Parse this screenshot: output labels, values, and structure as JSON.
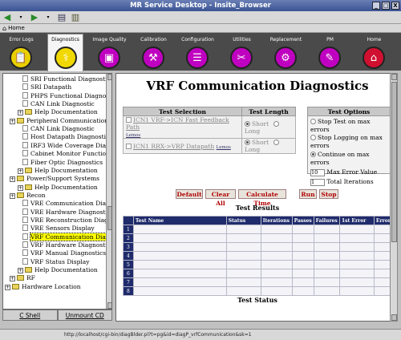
{
  "window": {
    "title": "MR Service Desktop - Insite_Browser",
    "controls": [
      "_",
      "□",
      "X"
    ]
  },
  "toolbar": {
    "home_label": "Home"
  },
  "nav": {
    "tabs": [
      {
        "label": "Error Logs",
        "icon": "📋",
        "color": "#e8d000"
      },
      {
        "label": "Diagnostics",
        "icon": "⚕",
        "color": "#f0d800"
      },
      {
        "label": "Image Quality",
        "icon": "▣",
        "color": "#c000c0"
      },
      {
        "label": "Calibration",
        "icon": "⚒",
        "color": "#c000c0"
      },
      {
        "label": "Configuration",
        "icon": "☰",
        "color": "#c000c0"
      },
      {
        "label": "Utilities",
        "icon": "✂",
        "color": "#c000c0"
      },
      {
        "label": "Replacement",
        "icon": "⚙",
        "color": "#c000c0"
      },
      {
        "label": "PM",
        "icon": "✎",
        "color": "#c000c0"
      },
      {
        "label": "Home",
        "icon": "⌂",
        "color": "#d01030"
      }
    ]
  },
  "tree": {
    "items": [
      {
        "label": "SRI Functional Diagnostics",
        "kind": "doc",
        "indent": 2
      },
      {
        "label": "SRI Datapath",
        "kind": "doc",
        "indent": 2
      },
      {
        "label": "PHPS Functional Diagnostics",
        "kind": "doc",
        "indent": 2
      },
      {
        "label": "CAN Link Diagnostic",
        "kind": "doc",
        "indent": 2
      },
      {
        "label": "Help Documentation",
        "kind": "folder",
        "indent": 1
      },
      {
        "label": "Peripheral Communications",
        "kind": "folder",
        "indent": 0
      },
      {
        "label": "CAN Link Diagnostic",
        "kind": "doc",
        "indent": 2
      },
      {
        "label": "Host Datapath Diagnostic",
        "kind": "doc",
        "indent": 2
      },
      {
        "label": "IRF3 Wide Coverage Diagnost",
        "kind": "doc",
        "indent": 2
      },
      {
        "label": "Cabinet Monitor Functional Di",
        "kind": "doc",
        "indent": 2
      },
      {
        "label": "Fiber Optic Diagnostics",
        "kind": "doc",
        "indent": 2
      },
      {
        "label": "Help Documentation",
        "kind": "folder",
        "indent": 1
      },
      {
        "label": "Power/Support Systems",
        "kind": "folder",
        "indent": 0
      },
      {
        "label": "Help Documentation",
        "kind": "folder",
        "indent": 1
      },
      {
        "label": "Recon",
        "kind": "folder",
        "indent": 0
      },
      {
        "label": "VRE Communication Diagnos",
        "kind": "doc",
        "indent": 2
      },
      {
        "label": "VRE Hardware Diagnostics",
        "kind": "doc",
        "indent": 2
      },
      {
        "label": "VRE Reconstruction Diagnost",
        "kind": "doc",
        "indent": 2
      },
      {
        "label": "VRE Sensors Display",
        "kind": "doc",
        "indent": 2
      },
      {
        "label": "VRF Communication Diagnos",
        "kind": "doc",
        "indent": 2,
        "selected": true
      },
      {
        "label": "VRF Hardware Diagnostics",
        "kind": "doc",
        "indent": 2
      },
      {
        "label": "VRF Manual Diagnostics",
        "kind": "doc",
        "indent": 2
      },
      {
        "label": "VRF Status Display",
        "kind": "doc",
        "indent": 2
      },
      {
        "label": "Help Documentation",
        "kind": "folder",
        "indent": 1
      },
      {
        "label": "RF",
        "kind": "folder",
        "indent": 0
      },
      {
        "label": "Hardware Location",
        "kind": "folder",
        "indent": -1
      }
    ]
  },
  "bottom_tabs": [
    "C Shell",
    "Unmount CD"
  ],
  "page": {
    "title": "VRF Communication Diagnostics",
    "test_selection": {
      "header": "Test Selection",
      "length_header": "Test Length",
      "rows": [
        {
          "name": "ICN1 VRF->ICN Fast Feedback Path",
          "link": "Lemos",
          "short": "Short",
          "long": "Long"
        },
        {
          "name": "ICN1 RRX->VRP Datapath",
          "link": "Lemos",
          "short": "Short",
          "long": "Long"
        }
      ]
    },
    "test_options": {
      "header": "Test Options",
      "radios": [
        "Stop Test on max errors",
        "Stop Logging on max errors",
        "Continue on max errors"
      ],
      "max_error_value": "10",
      "max_error_label": "Max Error Value",
      "total_iterations_value": "1",
      "total_iterations_label": "Total Iterations"
    },
    "buttons": [
      "Default",
      "Clear All",
      "Calculate Time",
      "Run",
      "Stop"
    ],
    "results": {
      "title": "Test Results",
      "columns": [
        "Test Name",
        "Status",
        "Iterations",
        "Passes",
        "Failures",
        "1st Error",
        "Errors"
      ],
      "rows": [
        "1",
        "2",
        "3",
        "4",
        "5",
        "6",
        "7",
        "8"
      ]
    },
    "status_title": "Test Status"
  },
  "statusbar": {
    "url": "http://localhost/cgi-bin/diagBlder.pl?t=pg&id=diagP_vrfCommunication&sk=1"
  }
}
